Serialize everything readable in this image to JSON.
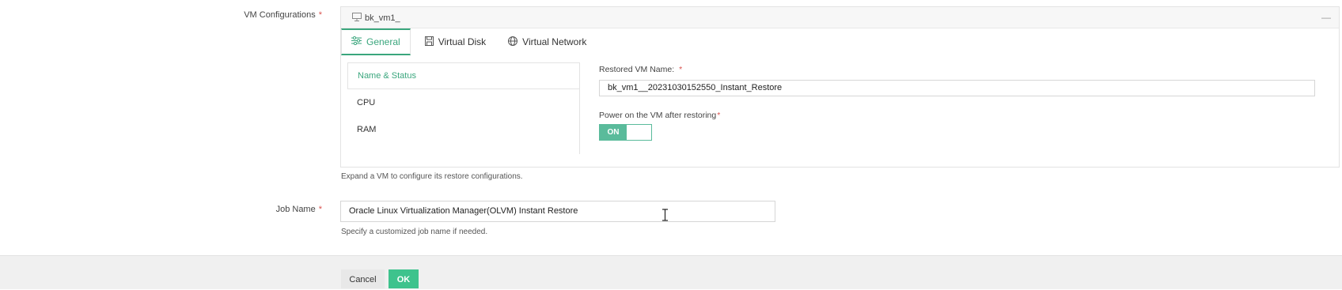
{
  "vm_configurations": {
    "label": "VM Configurations",
    "required_mark": "*",
    "vm_name": "bk_vm1_",
    "collapse_symbol": "—",
    "tabs": [
      {
        "label": "General",
        "icon": "sliders-icon"
      },
      {
        "label": "Virtual Disk",
        "icon": "disk-icon"
      },
      {
        "label": "Virtual Network",
        "icon": "globe-icon"
      }
    ],
    "sections": [
      "Name & Status",
      "CPU",
      "RAM"
    ],
    "restored_name_label": "Restored VM Name:",
    "restored_name_value": "bk_vm1__20231030152550_Instant_Restore",
    "power_on_label": "Power on the VM after restoring",
    "power_on_state": "ON",
    "hint": "Expand a VM to configure its restore configurations."
  },
  "job_name": {
    "label": "Job Name",
    "required_mark": "*",
    "value": "Oracle Linux Virtualization Manager(OLVM) Instant Restore",
    "hint": "Specify a customized job name if needed."
  },
  "footer": {
    "cancel_label": "Cancel",
    "ok_label": "OK"
  },
  "colors": {
    "accent": "#3aa67d",
    "ok_button": "#3ec38d",
    "toggle_on": "#5abb9b",
    "required": "#d9534f"
  }
}
